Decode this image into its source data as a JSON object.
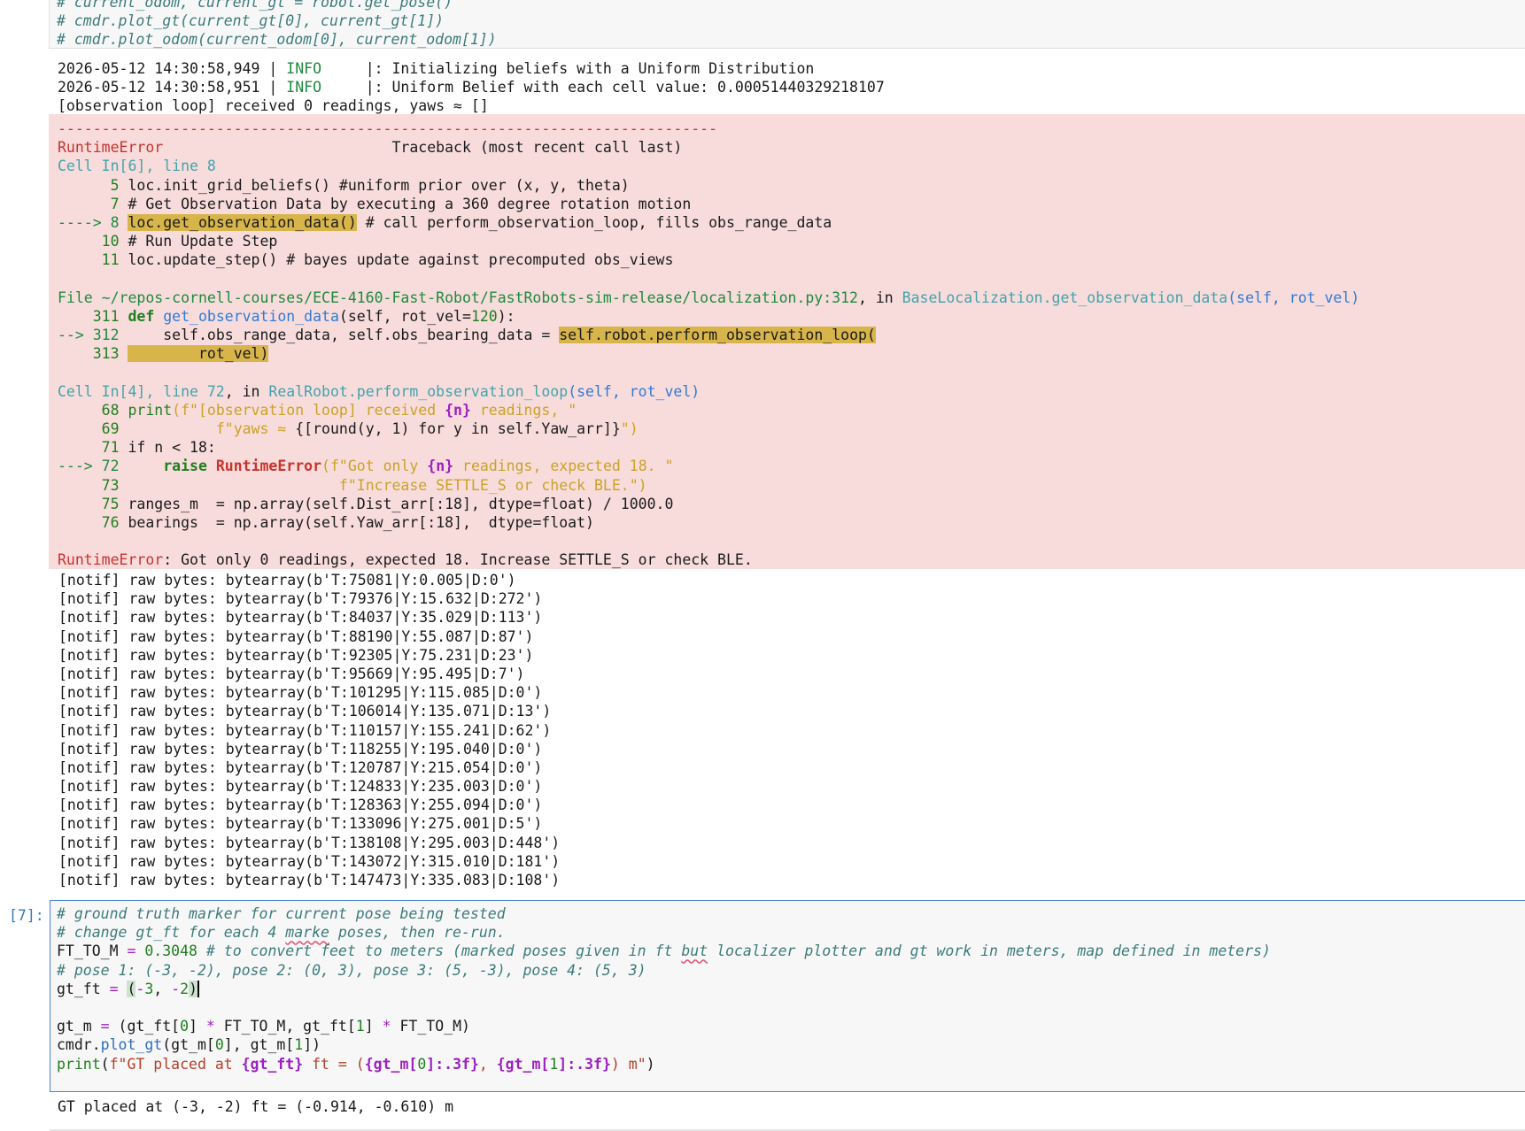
{
  "top_cell": {
    "lines": [
      "# current_odom, current_gt = robot.get_pose()",
      "# cmdr.plot_gt(current_gt[0], current_gt[1])",
      "# cmdr.plot_odom(current_odom[0], current_odom[1])"
    ]
  },
  "info_log": {
    "line1_prefix": "2026-05-12 14:30:58,949 | ",
    "line1_level": "INFO",
    "line1_msg": "     |: Initializing beliefs with a Uniform Distribution",
    "line2_prefix": "2026-05-12 14:30:58,951 | ",
    "line2_level": "INFO",
    "line2_msg": "     |: Uniform Belief with each cell value: 0.00051440329218107",
    "line3": "[observation loop] received 0 readings, yaws ≈ []"
  },
  "traceback": {
    "dashes": "---------------------------------------------------------------------------",
    "error_type": "RuntimeError",
    "traceback_header": "                          Traceback (most recent call last)",
    "cell6_loc": "Cell In[6], line 8",
    "frame1": [
      {
        "num": "      5 ",
        "code": "loc.init_grid_beliefs() #uniform prior over (x, y, theta)"
      },
      {
        "num": "      7 ",
        "code": "# Get Observation Data by executing a 360 degree rotation motion"
      }
    ],
    "frame1_arrow": "----> 8 ",
    "frame1_hl": "loc.get_observation_data()",
    "frame1_rest": " # call perform_observation_loop, fills obs_range_data",
    "frame1_after": [
      {
        "num": "     10 ",
        "code": "# Run Update Step"
      },
      {
        "num": "     11 ",
        "code": "loc.update_step() # bayes update against precomputed obs_views"
      }
    ],
    "file_prefix": "File ~/repos-cornell-courses/ECE-4160-Fast-Robot/FastRobots-sim-release/localization.py:312",
    "file_in": ", in ",
    "file_func": "BaseLocalization.get_observation_data",
    "file_args": "(self, rot_vel)",
    "f2_l311_num": "    311 ",
    "f2_l311_def": "def",
    "f2_l311_name": " get_observation_data",
    "f2_l311_rest": "(self, rot_vel=",
    "f2_l311_val": "120",
    "f2_l311_end": "):",
    "f2_arrow": "--> 312 ",
    "f2_l312_code": "    self.obs_range_data, self.obs_bearing_data = ",
    "f2_l312_hl": "self.robot.perform_observation_loop(",
    "f2_l313_num": "    313 ",
    "f2_l313_hl": "        rot_vel)",
    "cell4_loc": "Cell In[4], line 72",
    "cell4_in": ", in ",
    "cell4_func": "RealRobot.perform_observation_loop",
    "cell4_args": "(self, rot_vel)",
    "f3_l68_num": "     68 ",
    "f3_l68_print": "print",
    "f3_l68_str1": "(f\"[observation loop] received ",
    "f3_l68_var": "{n}",
    "f3_l68_str2": " readings, \"",
    "f3_l69_num": "     69 ",
    "f3_l69_str": "          f\"yaws ≈ ",
    "f3_l69_expr": "{[round(y, 1) for y in self.Yaw_arr]}",
    "f3_l69_end": "\")",
    "f3_l71_num": "     71 ",
    "f3_l71_code": "if n < 18:",
    "f3_arrow": "---> 72 ",
    "f3_l72_raise": "    raise ",
    "f3_l72_err": "RuntimeError",
    "f3_l72_str1": "(f\"Got only ",
    "f3_l72_var": "{n}",
    "f3_l72_str2": " readings, expected 18. \"",
    "f3_l73_num": "     73 ",
    "f3_l73_str": "                        f\"Increase SETTLE_S or check BLE.\")",
    "f3_l75_num": "     75 ",
    "f3_l75_code": "ranges_m  = np.array(self.Dist_arr[:18], dtype=float) / 1000.0",
    "f3_l76_num": "     76 ",
    "f3_l76_code": "bearings  = np.array(self.Yaw_arr[:18],  dtype=float)",
    "final_type": "RuntimeError",
    "final_msg": ": Got only 0 readings, expected 18. Increase SETTLE_S or check BLE."
  },
  "notif_lines": [
    "[notif] raw bytes: bytearray(b'T:75081|Y:0.005|D:0')",
    "[notif] raw bytes: bytearray(b'T:79376|Y:15.632|D:272')",
    "[notif] raw bytes: bytearray(b'T:84037|Y:35.029|D:113')",
    "[notif] raw bytes: bytearray(b'T:88190|Y:55.087|D:87')",
    "[notif] raw bytes: bytearray(b'T:92305|Y:75.231|D:23')",
    "[notif] raw bytes: bytearray(b'T:95669|Y:95.495|D:7')",
    "[notif] raw bytes: bytearray(b'T:101295|Y:115.085|D:0')",
    "[notif] raw bytes: bytearray(b'T:106014|Y:135.071|D:13')",
    "[notif] raw bytes: bytearray(b'T:110157|Y:155.241|D:62')",
    "[notif] raw bytes: bytearray(b'T:118255|Y:195.040|D:0')",
    "[notif] raw bytes: bytearray(b'T:120787|Y:215.054|D:0')",
    "[notif] raw bytes: bytearray(b'T:124833|Y:235.003|D:0')",
    "[notif] raw bytes: bytearray(b'T:128363|Y:255.094|D:0')",
    "[notif] raw bytes: bytearray(b'T:133096|Y:275.001|D:5')",
    "[notif] raw bytes: bytearray(b'T:138108|Y:295.003|D:448')",
    "[notif] raw bytes: bytearray(b'T:143072|Y:315.010|D:181')",
    "[notif] raw bytes: bytearray(b'T:147473|Y:335.083|D:108')"
  ],
  "cell7": {
    "prompt": "[7]:",
    "c1": "# ground truth marker for current pose being tested",
    "c2_a": "# change gt_ft for each 4 ",
    "c2_squig": "marke",
    "c2_b": " poses, then re-run.",
    "l3_var": "FT_TO_M ",
    "l3_eq": "=",
    "l3_num": " 0.3048",
    "l3_cmt_a": " # to convert feet to meters (marked poses given in ft ",
    "l3_cmt_squig": "but",
    "l3_cmt_b": " localizer plotter and gt work in meters, map defined in meters)",
    "c4": "# pose 1: (-3, -2), pose 2: (0, 3), pose 3: (5, -3), pose 4: (5, 3)",
    "l5_var": "gt_ft ",
    "l5_eq": "=",
    "l5_sp": " ",
    "l5_open": "(",
    "l5_minus1": "-",
    "l5_n1": "3",
    "l5_comma": ", ",
    "l5_minus2": "-",
    "l5_n2": "2",
    "l5_close": ")",
    "l7_a": "gt_m ",
    "l7_eq": "=",
    "l7_b": " (gt_ft[",
    "l7_i0": "0",
    "l7_c": "] ",
    "l7_mul1": "*",
    "l7_d": " FT_TO_M, gt_ft[",
    "l7_i1": "1",
    "l7_e": "] ",
    "l7_mul2": "*",
    "l7_f": " FT_TO_M)",
    "l8_a": "cmdr.",
    "l8_fn": "plot_gt",
    "l8_b": "(gt_m[",
    "l8_i0": "0",
    "l8_c": "], gt_m[",
    "l8_i1": "1",
    "l8_d": "])",
    "l9_print": "print",
    "l9_a": "(",
    "l9_s1": "f\"GT placed at ",
    "l9_v1": "{gt_ft}",
    "l9_s2": " ft = (",
    "l9_v2a": "{gt_m[",
    "l9_v2i": "0",
    "l9_v2b": "]",
    "l9_v2f": ":.3f}",
    "l9_s3": ", ",
    "l9_v3a": "{gt_m[",
    "l9_v3i": "1",
    "l9_v3b": "]",
    "l9_v3f": ":.3f}",
    "l9_s4": ") m\"",
    "l9_end": ")"
  },
  "out7": "GT placed at (-3, -2) ft = (-0.914, -0.610) m"
}
